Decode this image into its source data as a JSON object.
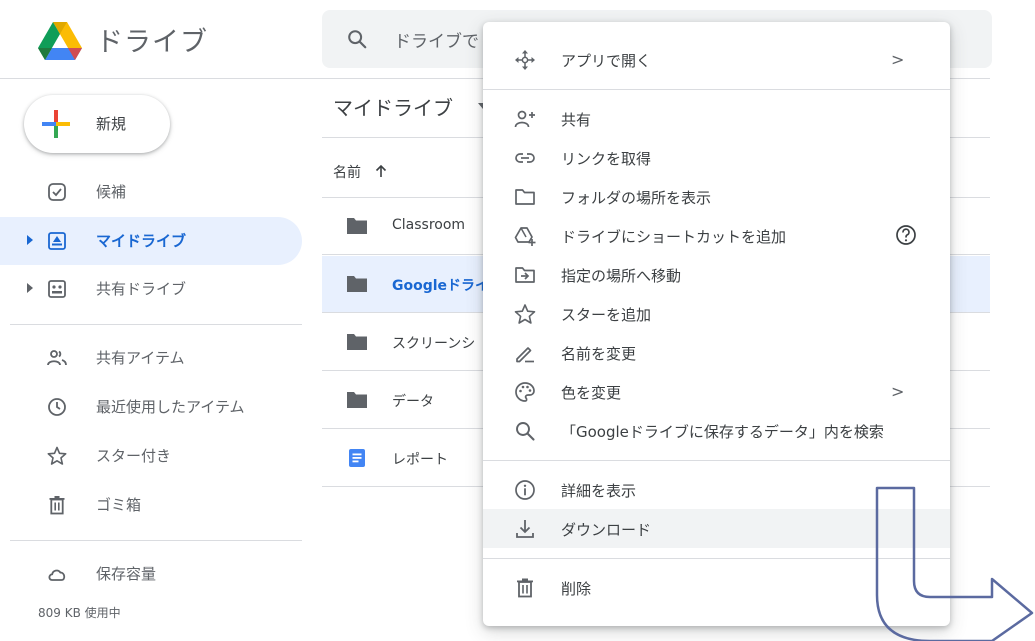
{
  "app": {
    "title": "ドライブ"
  },
  "search": {
    "value": "ドライブで"
  },
  "sidebar": {
    "new_button": "新規",
    "items": [
      {
        "label": "候補"
      },
      {
        "label": "マイドライブ"
      },
      {
        "label": "共有ドライブ"
      },
      {
        "label": "共有アイテム"
      },
      {
        "label": "最近使用したアイテム"
      },
      {
        "label": "スター付き"
      },
      {
        "label": "ゴミ箱"
      },
      {
        "label": "保存容量"
      }
    ],
    "storage_used": "809 KB 使用中"
  },
  "main": {
    "breadcrumb": "マイドライブ",
    "column_name": "名前",
    "files": [
      {
        "name": "Classroom",
        "type": "folder"
      },
      {
        "name": "Googleドライ",
        "type": "folder"
      },
      {
        "name": "スクリーンシ",
        "type": "folder"
      },
      {
        "name": "データ",
        "type": "folder"
      },
      {
        "name": "レポート",
        "type": "doc"
      }
    ]
  },
  "context_menu": {
    "items": [
      {
        "label": "アプリで開く",
        "chevron": ">"
      },
      {
        "label": "共有"
      },
      {
        "label": "リンクを取得"
      },
      {
        "label": "フォルダの場所を表示"
      },
      {
        "label": "ドライブにショートカットを追加"
      },
      {
        "label": "指定の場所へ移動"
      },
      {
        "label": "スターを追加"
      },
      {
        "label": "名前を変更"
      },
      {
        "label": "色を変更",
        "chevron": ">"
      },
      {
        "label": "「Googleドライブに保存するデータ」内を検索"
      },
      {
        "label": "詳細を表示"
      },
      {
        "label": "ダウンロード"
      },
      {
        "label": "削除"
      }
    ]
  },
  "colors": {
    "accent": "#1967d2",
    "selected_bg": "#e8f0fe",
    "hover_bg": "#f1f3f4",
    "overlay_arrow": "#5b6aa0"
  }
}
